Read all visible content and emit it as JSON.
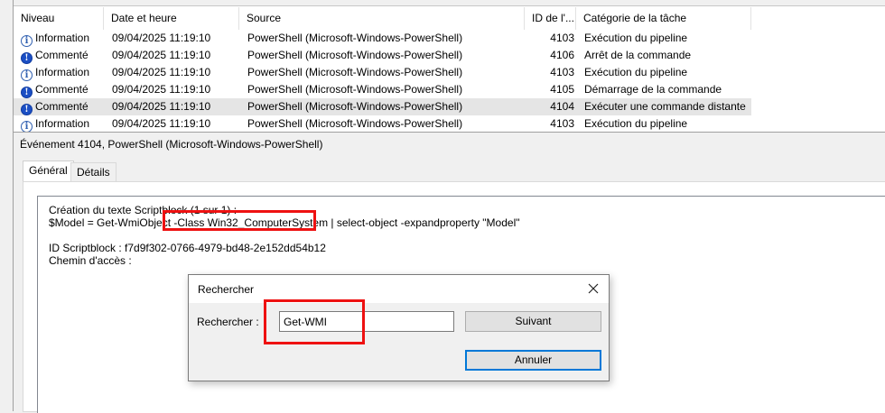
{
  "columns": {
    "level": "Niveau",
    "date": "Date et heure",
    "source": "Source",
    "id": "ID de l'...",
    "category": "Catégorie de la tâche"
  },
  "events": [
    {
      "icon": "information-icon",
      "level": "Information",
      "date": "09/04/2025 11:19:10",
      "source": "PowerShell (Microsoft-Windows-PowerShell)",
      "id": "4103",
      "category": "Exécution du pipeline"
    },
    {
      "icon": "verbose-icon",
      "level": "Commenté",
      "date": "09/04/2025 11:19:10",
      "source": "PowerShell (Microsoft-Windows-PowerShell)",
      "id": "4106",
      "category": "Arrêt de la commande"
    },
    {
      "icon": "information-icon",
      "level": "Information",
      "date": "09/04/2025 11:19:10",
      "source": "PowerShell (Microsoft-Windows-PowerShell)",
      "id": "4103",
      "category": "Exécution du pipeline"
    },
    {
      "icon": "verbose-icon",
      "level": "Commenté",
      "date": "09/04/2025 11:19:10",
      "source": "PowerShell (Microsoft-Windows-PowerShell)",
      "id": "4105",
      "category": "Démarrage de la commande"
    },
    {
      "icon": "verbose-icon",
      "level": "Commenté",
      "date": "09/04/2025 11:19:10",
      "source": "PowerShell (Microsoft-Windows-PowerShell)",
      "id": "4104",
      "category": "Exécuter une commande distante",
      "selected": true
    },
    {
      "icon": "information-icon",
      "level": "Information",
      "date": "09/04/2025 11:19:10",
      "source": "PowerShell (Microsoft-Windows-PowerShell)",
      "id": "4103",
      "category": "Exécution du pipeline"
    }
  ],
  "details": {
    "title": "Événement 4104, PowerShell (Microsoft-Windows-PowerShell)",
    "tabs": [
      "Général",
      "Détails"
    ],
    "line1": "Création du texte Scriptblock (1 sur 1) :",
    "line2_pre": "$Model = Get-WmiObject ",
    "line2_hl": "-Class Win32_ComputerSystem",
    "line2_post": " | select-object -expandproperty \"Model\"",
    "line3": "ID Scriptblock : f7d9f302-0766-4979-bd48-2e152dd54b12",
    "line4": "Chemin d'accès :"
  },
  "dialog": {
    "title": "Rechercher",
    "label": "Rechercher :",
    "value": "Get-WMI",
    "next": "Suivant",
    "cancel": "Annuler",
    "close_icon": "close-icon"
  },
  "colors": {
    "highlight": "#ee1111",
    "selected_row": "#e5e5e5",
    "focus_button": "#0078d7"
  }
}
